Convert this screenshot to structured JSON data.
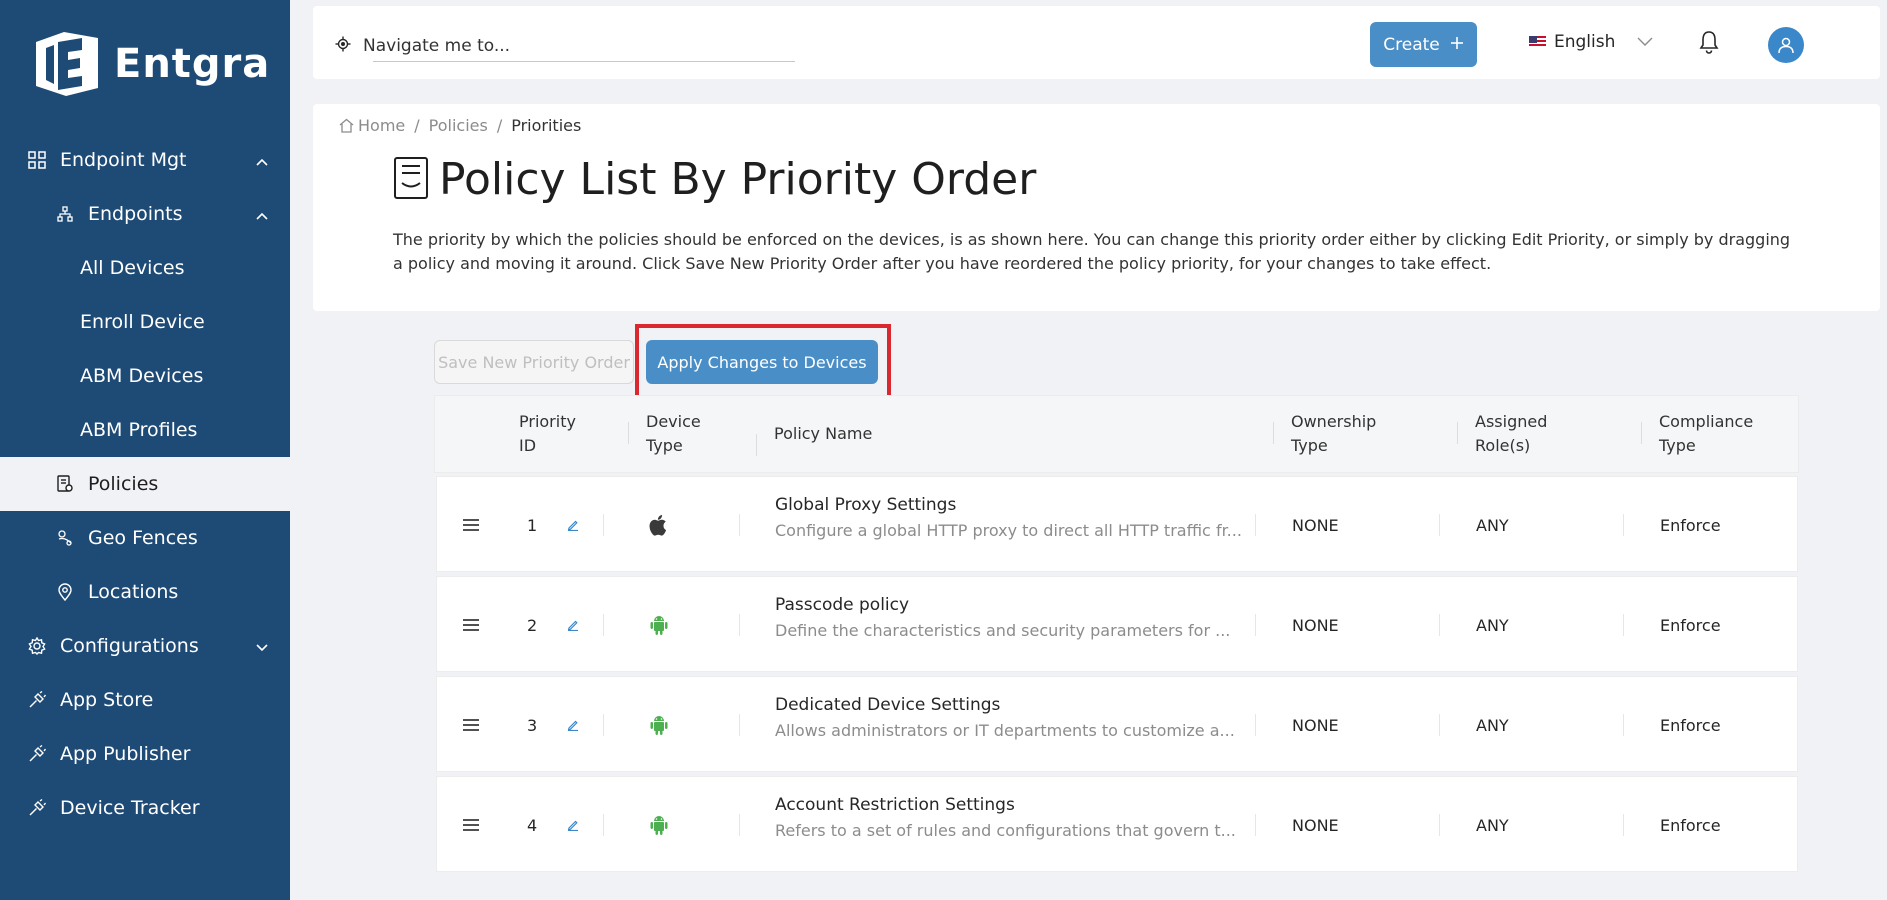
{
  "brand": {
    "name": "Entgra"
  },
  "sidebar": {
    "items": [
      {
        "label": "Endpoint Mgt",
        "icon": "grid-icon",
        "level": 0,
        "chevron": "up"
      },
      {
        "label": "Endpoints",
        "icon": "hierarchy-icon",
        "level": 1,
        "chevron": "up"
      },
      {
        "label": "All Devices",
        "level": 2
      },
      {
        "label": "Enroll Device",
        "level": 2
      },
      {
        "label": "ABM Devices",
        "level": 2
      },
      {
        "label": "ABM Profiles",
        "level": 2
      },
      {
        "label": "Policies",
        "icon": "policy-icon",
        "level": 1,
        "active": true
      },
      {
        "label": "Geo Fences",
        "icon": "geofence-icon",
        "level": 1
      },
      {
        "label": "Locations",
        "icon": "location-icon",
        "level": 1
      },
      {
        "label": "Configurations",
        "icon": "gear-icon",
        "level": 0,
        "chevron": "down"
      },
      {
        "label": "App Store",
        "icon": "plug-icon",
        "level": 0
      },
      {
        "label": "App Publisher",
        "icon": "plug-icon",
        "level": 0
      },
      {
        "label": "Device Tracker",
        "icon": "plug-icon",
        "level": 0
      }
    ]
  },
  "header": {
    "navigate_placeholder": "Navigate me to...",
    "create_label": "Create",
    "language": "English"
  },
  "breadcrumb": {
    "home": "Home",
    "policies": "Policies",
    "current": "Priorities"
  },
  "page": {
    "title": "Policy List By Priority Order",
    "description": "The priority by which the policies should be enforced on the devices, is as shown here. You can change this priority order either by clicking Edit Priority, or simply by dragging a policy and moving it around. Click Save New Priority Order after you have reordered the policy priority, for your changes to take effect."
  },
  "actions": {
    "save_label": "Save New Priority Order",
    "apply_label": "Apply Changes to Devices"
  },
  "table": {
    "headers": {
      "priority_id": [
        "Priority",
        "ID"
      ],
      "device_type": [
        "Device",
        "Type"
      ],
      "policy_name": "Policy Name",
      "ownership": [
        "Ownership",
        "Type"
      ],
      "roles": [
        "Assigned",
        "Role(s)"
      ],
      "compliance": [
        "Compliance",
        "Type"
      ]
    },
    "rows": [
      {
        "priority": "1",
        "device": "apple",
        "name": "Global Proxy Settings",
        "desc": "Configure a global HTTP proxy to direct all HTTP traffic fr...",
        "ownership": "NONE",
        "roles": "ANY",
        "compliance": "Enforce"
      },
      {
        "priority": "2",
        "device": "android",
        "name": "Passcode policy",
        "desc": "Define the characteristics and security parameters for ...",
        "ownership": "NONE",
        "roles": "ANY",
        "compliance": "Enforce"
      },
      {
        "priority": "3",
        "device": "android",
        "name": "Dedicated Device Settings",
        "desc": "Allows administrators or IT departments to customize a...",
        "ownership": "NONE",
        "roles": "ANY",
        "compliance": "Enforce"
      },
      {
        "priority": "4",
        "device": "android",
        "name": "Account Restriction Settings",
        "desc": "Refers to a set of rules and configurations that govern t...",
        "ownership": "NONE",
        "roles": "ANY",
        "compliance": "Enforce"
      }
    ]
  },
  "colors": {
    "sidebar": "#1e4a76",
    "primary_button": "#4a8ec7",
    "highlight": "#d9282f",
    "android": "#4caf50"
  }
}
